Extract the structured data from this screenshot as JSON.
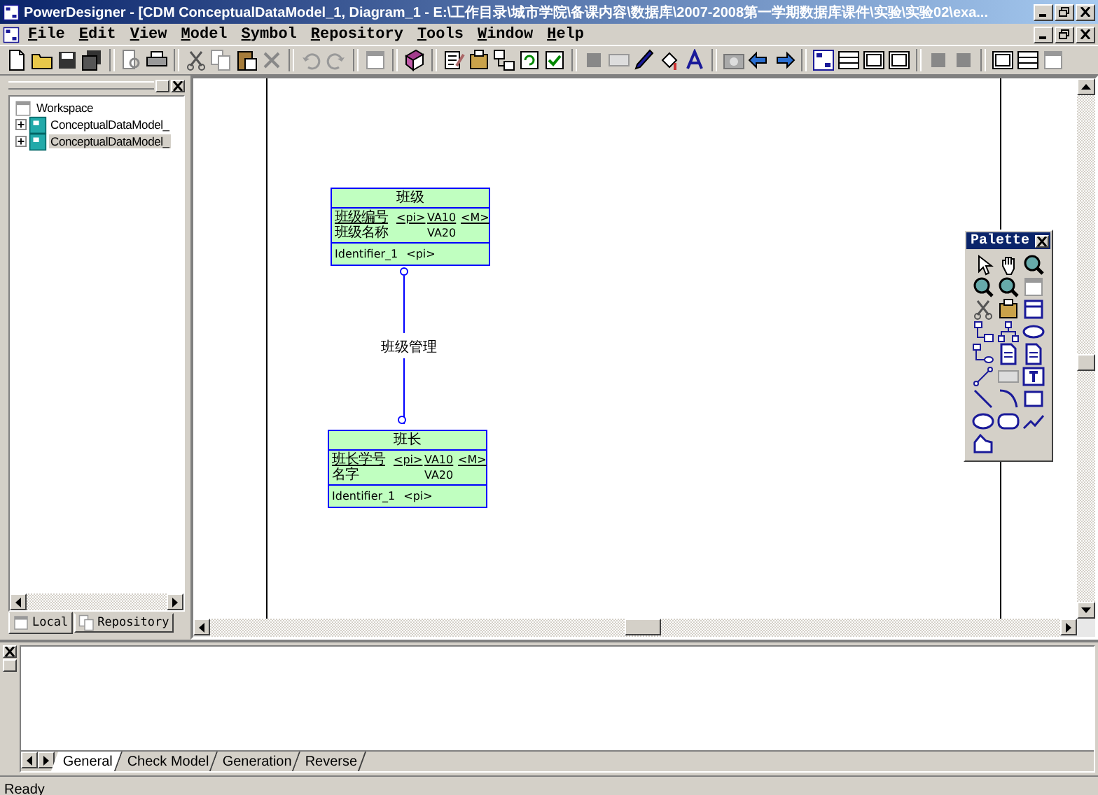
{
  "window": {
    "title": "PowerDesigner - [CDM ConceptualDataModel_1, Diagram_1 - E:\\工作目录\\城市学院\\备课内容\\数据库\\2007-2008第一学期数据库课件\\实验\\实验02\\exa..."
  },
  "menu": [
    "File",
    "Edit",
    "View",
    "Model",
    "Symbol",
    "Repository",
    "Tools",
    "Window",
    "Help"
  ],
  "browser": {
    "tree": {
      "label": "Workspace",
      "children": [
        {
          "label": "ConceptualDataModel_",
          "expanded": false,
          "selected": false
        },
        {
          "label": "ConceptualDataModel_",
          "expanded": false,
          "selected": true
        }
      ]
    },
    "tabs": [
      {
        "label": "Local",
        "selected": true
      },
      {
        "label": "Repository",
        "selected": false
      }
    ]
  },
  "diagram": {
    "entities": [
      {
        "name": "班级",
        "attributes": [
          {
            "name": "班级编号",
            "key": "<pi>",
            "type": "VA10",
            "mandatory": "<M>",
            "primary": true
          },
          {
            "name": "班级名称",
            "type": "VA20",
            "primary": false
          }
        ],
        "identifiers": [
          {
            "name": "Identifier_1",
            "key": "<pi>"
          }
        ]
      },
      {
        "name": "班长",
        "attributes": [
          {
            "name": "班长学号",
            "key": "<pi>",
            "type": "VA10",
            "mandatory": "<M>",
            "primary": true
          },
          {
            "name": "名字",
            "type": "VA20",
            "primary": false
          }
        ],
        "identifiers": [
          {
            "name": "Identifier_1",
            "key": "<pi>"
          }
        ]
      }
    ],
    "relationships": [
      {
        "name": "班级管理"
      }
    ],
    "palette": {
      "title": "Palette"
    }
  },
  "output": {
    "tabs": [
      {
        "label": "General",
        "selected": true
      },
      {
        "label": "Check Model",
        "selected": false
      },
      {
        "label": "Generation",
        "selected": false
      },
      {
        "label": "Reverse",
        "selected": false
      }
    ]
  },
  "status_bar": {
    "text": "Ready"
  }
}
